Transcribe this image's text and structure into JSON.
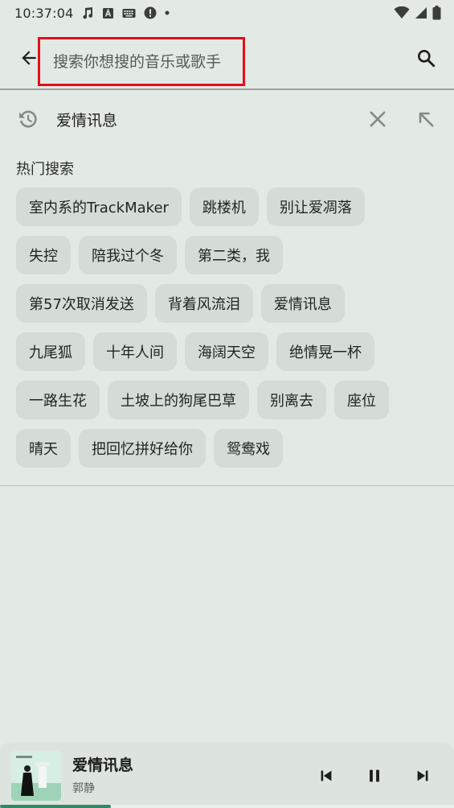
{
  "status_bar": {
    "time": "10:37:04",
    "icons_left": [
      "music-note-icon",
      "text-a-icon",
      "keyboard-icon",
      "alert-icon",
      "dot-icon"
    ],
    "icons_right": [
      "wifi-icon",
      "signal-icon",
      "battery-icon"
    ]
  },
  "search": {
    "placeholder": "搜索你想搜的音乐或歌手",
    "value": "",
    "highlight_color": "#e0101a"
  },
  "history": {
    "items": [
      {
        "text": "爱情讯息"
      }
    ]
  },
  "hot_search": {
    "title": "热门搜索",
    "rows": [
      [
        "室内系的TrackMaker",
        "跳楼机",
        "别让爱凋落"
      ],
      [
        "失控",
        "陪我过个冬",
        "第二类，我"
      ],
      [
        "第57次取消发送",
        "背着风流泪",
        "爱情讯息"
      ],
      [
        "九尾狐",
        "十年人间",
        "海阔天空",
        "绝情晃一杯"
      ],
      [
        "一路生花",
        "土坡上的狗尾巴草",
        "别离去",
        "座位"
      ],
      [
        "晴天",
        "把回忆拼好给你",
        "鸳鸯戏"
      ]
    ]
  },
  "player": {
    "title": "爱情讯息",
    "artist": "郭静",
    "progress": 0.245,
    "accent": "#2f8a62"
  }
}
